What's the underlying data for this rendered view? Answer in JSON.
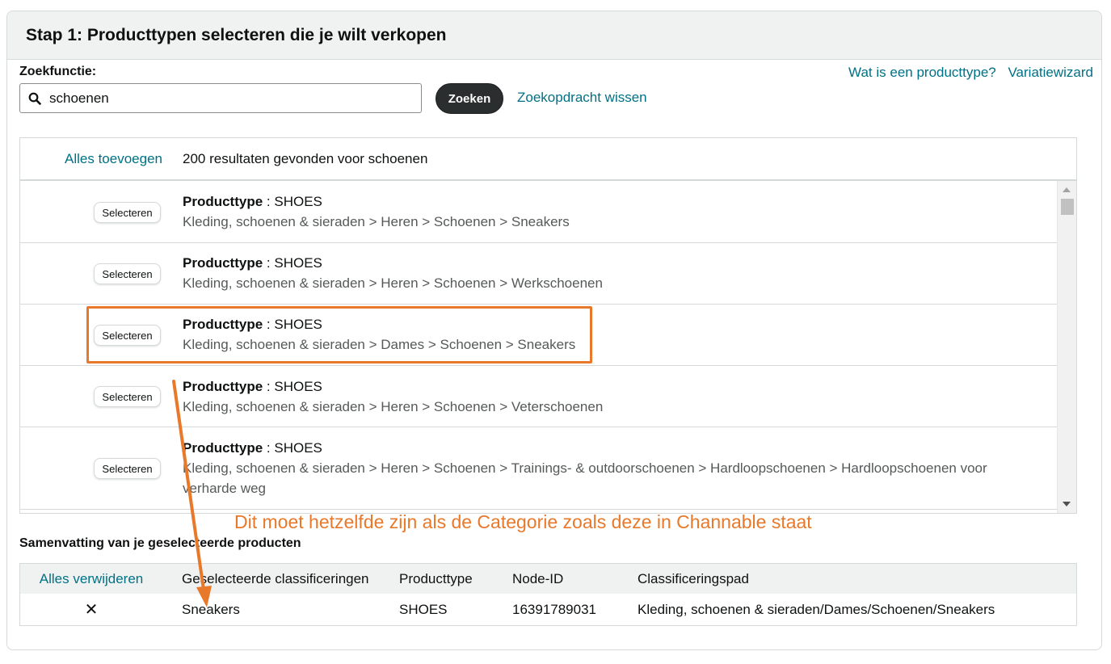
{
  "panel": {
    "title": "Stap 1: Producttypen selecteren die je wilt verkopen"
  },
  "search": {
    "label": "Zoekfunctie:",
    "value": "schoenen",
    "button": "Zoeken",
    "clear_link": "Zoekopdracht wissen"
  },
  "top_links": {
    "what_is": "Wat is een producttype?",
    "variation": "Variatiewizard"
  },
  "results": {
    "add_all": "Alles toevoegen",
    "count_text": "200 resultaten gevonden voor schoenen",
    "select_label": "Selecteren",
    "type_label": "Producttype",
    "items": [
      {
        "type": "SHOES",
        "path": "Kleding, schoenen & sieraden > Heren > Schoenen > Sneakers"
      },
      {
        "type": "SHOES",
        "path": "Kleding, schoenen & sieraden > Heren > Schoenen > Werkschoenen"
      },
      {
        "type": "SHOES",
        "path": "Kleding, schoenen & sieraden > Dames > Schoenen > Sneakers"
      },
      {
        "type": "SHOES",
        "path": "Kleding, schoenen & sieraden > Heren > Schoenen > Veterschoenen"
      },
      {
        "type": "SHOES",
        "path": "Kleding, schoenen & sieraden > Heren > Schoenen > Trainings- & outdoorschoenen > Hardloopschoenen > Hardloopschoenen voor verharde weg"
      }
    ]
  },
  "annotation": {
    "text": "Dit moet hetzelfde zijn als de Categorie zoals deze in Channable staat",
    "color": "#e8792a"
  },
  "summary": {
    "title": "Samenvatting van je geselecteerde producten",
    "remove_all": "Alles verwijderen",
    "columns": [
      "Geselecteerde classificeringen",
      "Producttype",
      "Node-ID",
      "Classificeringspad"
    ],
    "rows": [
      {
        "remove": "✕",
        "classification": "Sneakers",
        "type": "SHOES",
        "node_id": "16391789031",
        "path": "Kleding, schoenen & sieraden/Dames/Schoenen/Sneakers"
      }
    ]
  },
  "colors": {
    "link": "#007185",
    "button_dark": "#2b2e2e",
    "highlight": "#e8792a"
  }
}
